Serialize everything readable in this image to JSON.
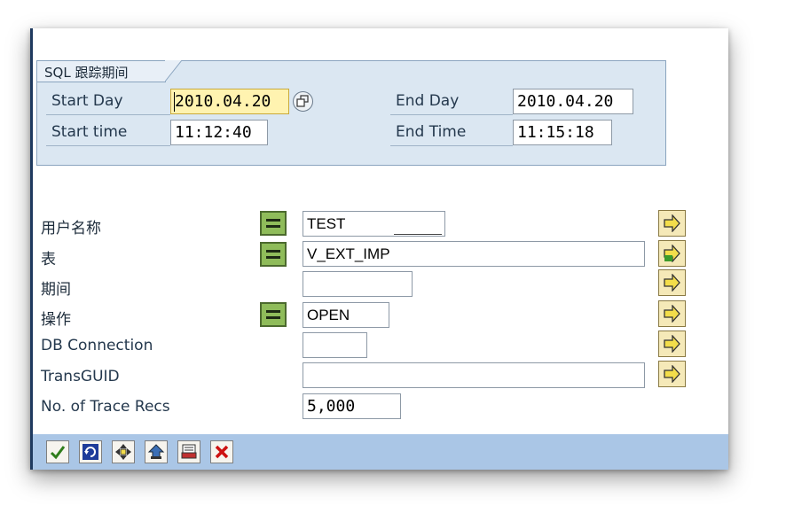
{
  "group": {
    "title": "SQL 跟踪期间",
    "start_day_label": "Start Day",
    "start_day_value": "2010.04.20",
    "start_time_label": "Start time",
    "start_time_value": "11:12:40",
    "end_day_label": "End Day",
    "end_day_value": "2010.04.20",
    "end_time_label": "End Time",
    "end_time_value": "11:15:18"
  },
  "fields": [
    {
      "label": "用户名称",
      "value": "TEST",
      "has_operator": true
    },
    {
      "label": "表",
      "value": "V_EXT_IMP",
      "has_operator": true
    },
    {
      "label": "期间",
      "value": "",
      "has_operator": false
    },
    {
      "label": "操作",
      "value": "OPEN",
      "has_operator": true
    },
    {
      "label": "DB Connection",
      "value": "",
      "has_operator": false
    },
    {
      "label": "TransGUID",
      "value": "",
      "has_operator": false
    },
    {
      "label": "No. of Trace Recs",
      "value": "5,000",
      "has_operator": false
    }
  ],
  "icons": {
    "operator": "equals-operator-icon",
    "multiple_selection": "multiple-selection-arrow-icon",
    "toolbar": [
      "check-icon",
      "refresh-icon",
      "navigate-icon",
      "save-icon",
      "print-icon",
      "cancel-icon"
    ]
  },
  "colors": {
    "group_bg": "#dbe7f2",
    "toolbar_bg": "#aac6e6",
    "operator_green": "#8fbc5a",
    "focused_field": "#fff3b0",
    "cancel_red": "#cc1111",
    "confirm_green": "#2f7d1c"
  }
}
